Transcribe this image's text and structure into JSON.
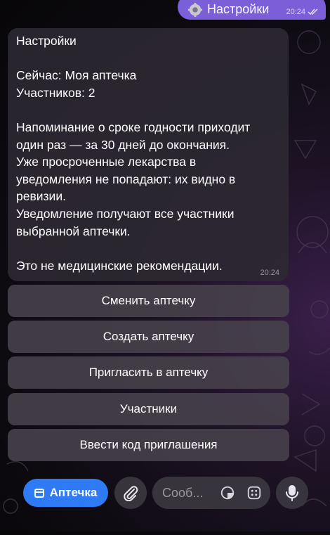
{
  "outgoing": {
    "text": "Настройки",
    "time": "20:24"
  },
  "message": {
    "lines": [
      "Настройки",
      "",
      "Сейчас: Моя аптечка",
      "Участников: 2",
      "",
      "Напоминание о сроке годности приходит",
      "один раз — за 30 дней до окончания.",
      "Уже просроченные лекарства в",
      "уведомления не попадают: их видно в",
      "ревизии.",
      "Уведомление получают все участники",
      "выбранной аптечки.",
      "",
      "Это не медицинские рекомендации."
    ],
    "time": "20:24"
  },
  "buttons": [
    "Сменить аптечку",
    "Создать аптечку",
    "Пригласить в аптечку",
    "Участники",
    "Ввести код приглашения"
  ],
  "bar": {
    "menu_label": "Аптечка",
    "placeholder": "Сооб..."
  },
  "colors": {
    "accent": "#2f7bf6",
    "outgoing_bubble": "#7a5fd8",
    "incoming_bubble": "#2c2832",
    "keyboard_button": "#48424c"
  }
}
